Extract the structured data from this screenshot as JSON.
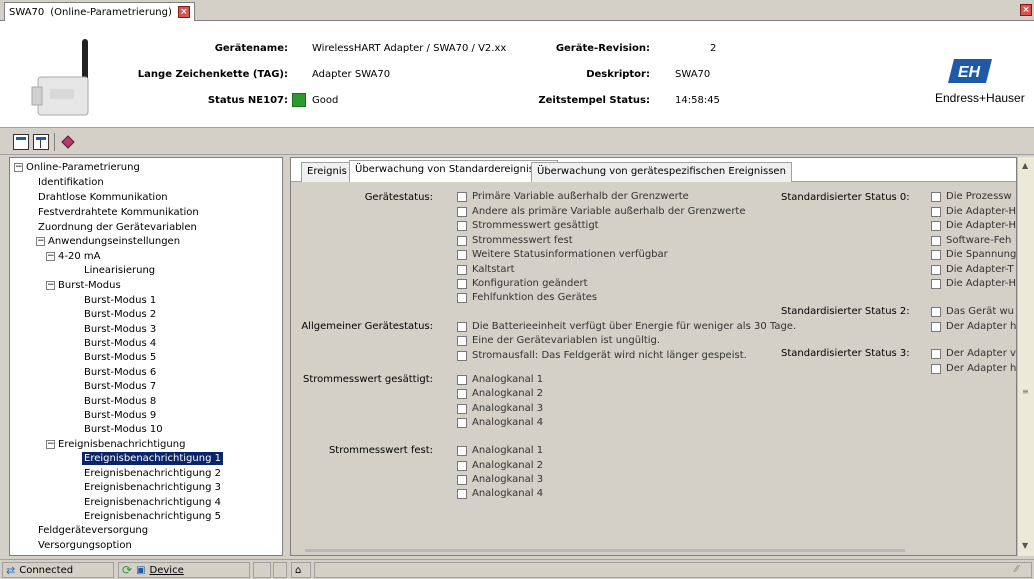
{
  "doc_tab": {
    "title": "SWA70",
    "subtitle": "(Online-Parametrierung)"
  },
  "header": {
    "device_name_label": "Gerätename:",
    "device_name_value": "WirelessHART Adapter / SWA70 / V2.xx",
    "tag_label": "Lange Zeichenkette (TAG):",
    "tag_value": "Adapter SWA70",
    "status_label": "Status NE107:",
    "status_value": "Good",
    "revision_label": "Geräte-Revision:",
    "revision_value": "2",
    "descriptor_label": "Deskriptor:",
    "descriptor_value": "SWA70",
    "timestamp_label": "Zeitstempel Status:",
    "timestamp_value": "14:58:45",
    "logo_text": "Endress+Hauser",
    "status_color": "#2e9a2e",
    "brand_color": "#1e5aa8"
  },
  "tree": {
    "root": "Online-Parametrierung",
    "identifikation": "Identifikation",
    "drahtlos": "Drahtlose Kommunikation",
    "festverdrahtet": "Festverdrahtete Kommunikation",
    "zuordnung": "Zuordnung der Gerätevariablen",
    "anwendung": "Anwendungseinstellungen",
    "ma": "4-20 mA",
    "linear": "Linearisierung",
    "burst": "Burst-Modus",
    "burst_items": [
      "Burst-Modus 1",
      "Burst-Modus 2",
      "Burst-Modus 3",
      "Burst-Modus 4",
      "Burst-Modus 5",
      "Burst-Modus 6",
      "Burst-Modus 7",
      "Burst-Modus 8",
      "Burst-Modus 9",
      "Burst-Modus 10"
    ],
    "ereignis": "Ereignisbenachrichtigung",
    "ereignis_items": [
      "Ereignisbenachrichtigung 1",
      "Ereignisbenachrichtigung 2",
      "Ereignisbenachrichtigung 3",
      "Ereignisbenachrichtigung 4",
      "Ereignisbenachrichtigung 5"
    ],
    "feldgeraet": "Feldgeräteversorgung",
    "versorgung": "Versorgungsoption"
  },
  "tabs": [
    "Ereignis",
    "Überwachung von Standardereignissen",
    "Überwachung von gerätespezifischen Ereignissen"
  ],
  "content": {
    "geraetestatus_label": "Gerätestatus:",
    "geraetestatus": [
      "Primäre Variable außerhalb der Grenzwerte",
      "Andere als primäre Variable außerhalb der Grenzwerte",
      "Strommesswert gesättigt",
      "Strommesswert fest",
      "Weitere Statusinformationen verfügbar",
      "Kaltstart",
      "Konfiguration geändert",
      "Fehlfunktion des Gerätes"
    ],
    "allgemein_label": "Allgemeiner Gerätestatus:",
    "allgemein": [
      "Die Batterieeinheit verfügt über Energie für weniger als 30 Tage.",
      "Eine der Gerätevariablen ist ungültig.",
      "Stromausfall: Das Feldgerät wird nicht länger gespeist."
    ],
    "gesaettigt_label": "Strommesswert gesättigt:",
    "gesaettigt": [
      "Analogkanal 1",
      "Analogkanal 2",
      "Analogkanal 3",
      "Analogkanal 4"
    ],
    "fest_label": "Strommesswert fest:",
    "fest": [
      "Analogkanal 1",
      "Analogkanal 2",
      "Analogkanal 3",
      "Analogkanal 4"
    ],
    "std0_label": "Standardisierter Status 0:",
    "std0": [
      "Die Prozessw",
      "Die Adapter-H",
      "Die Adapter-H",
      "Software-Feh",
      "Die Spannung",
      "Die Adapter-T",
      "Die Adapter-H"
    ],
    "std2_label": "Standardisierter Status 2:",
    "std2": [
      "Das Gerät wu",
      "Der Adapter h"
    ],
    "std3_label": "Standardisierter Status 3:",
    "std3": [
      "Der Adapter v",
      "Der Adapter h"
    ]
  },
  "statusbar": {
    "connected": "Connected",
    "device": "Device"
  }
}
